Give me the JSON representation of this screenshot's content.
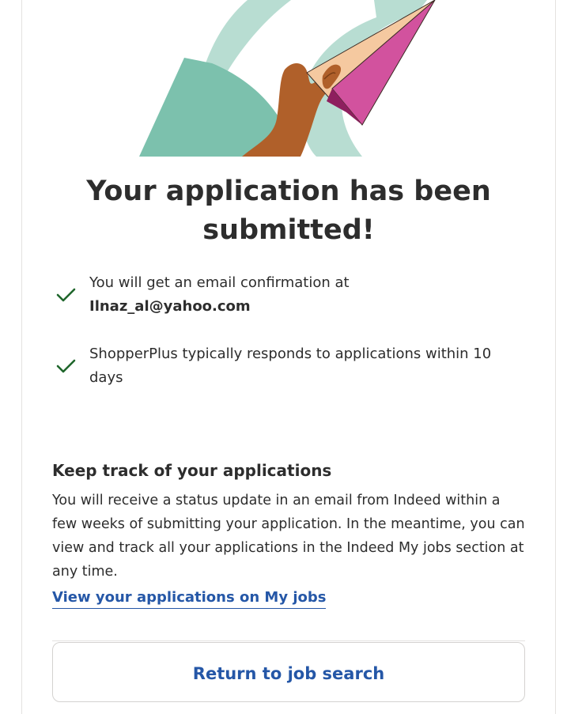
{
  "headline": "Your application has been submitted!",
  "confirmations": [
    {
      "text": "You will get an email confirmation at",
      "email": "Ilnaz_al@yahoo.com"
    },
    {
      "text": "ShopperPlus typically responds to applications within 10 days"
    }
  ],
  "tracking": {
    "heading": "Keep track of your applications",
    "body": "You will receive a status update in an email from Indeed within a few weeks of submitting your application. In the meantime, you can view and track all your applications in the Indeed My jobs section at any time.",
    "link_label": "View your applications on My jobs"
  },
  "return_button_label": "Return to job search",
  "colors": {
    "link_blue": "#2557a7",
    "check_green": "#1f662c",
    "teal_dark": "#7cc1ad",
    "teal_light": "#b8ddd2",
    "hand_brown": "#b0602a",
    "plane_pink": "#c6398c",
    "plane_peach": "#f5c9a0"
  },
  "icons": {
    "check": "checkmark-icon",
    "illustration": "paper-plane-hand-illustration"
  }
}
